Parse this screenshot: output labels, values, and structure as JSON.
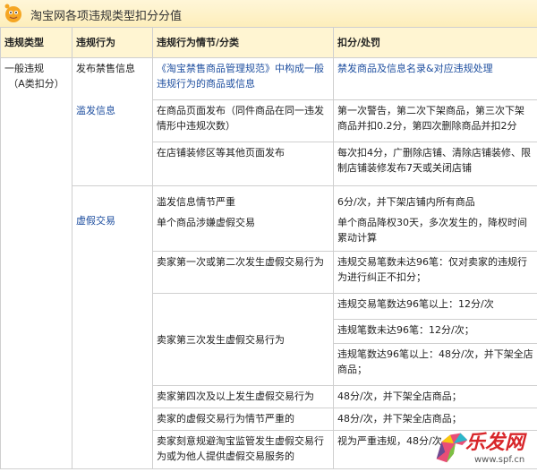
{
  "title": "淘宝网各项违规类型扣分分值",
  "headers": [
    "违规类型",
    "违规行为",
    "违规行为情节/分类",
    "扣分/处罚"
  ],
  "col1": {
    "type_line1": "一般违规",
    "type_line2": "（A类扣分）"
  },
  "behaviors": {
    "b1": "发布禁售信息",
    "b2": "滥发信息",
    "b3": "虚假交易"
  },
  "rows": {
    "r1": {
      "detail": "《淘宝禁售商品管理规范》中构成一般违规行为的商品或信息",
      "penalty": "禁发商品及信息名录&对应违规处理"
    },
    "r2": {
      "detail": "在商品页面发布（同件商品在同一违发情形中违规次数）",
      "penalty": "第一次警告，第二次下架商品，第三次下架商品并扣0.2分，第四次删除商品并扣2分"
    },
    "r3": {
      "detail": "在店铺装修区等其他页面发布",
      "penalty": "每次扣4分，广删除店铺、清除店铺装修、限制店铺装修发布7天或关闭店铺"
    },
    "r4": {
      "detail_a": "滥发信息情节严重",
      "detail_b": "单个商品涉嫌虚假交易",
      "penalty_a": "6分/次，并下架店铺内所有商品",
      "penalty_b": "单个商品降权30天，多次发生的，降权时间累动计算"
    },
    "r5": {
      "detail": "卖家第一次或第二次发生虚假交易行为",
      "penalty": "违规交易笔数未达96笔：仅对卖家的违规行为进行纠正不扣分；"
    },
    "r6": {
      "detail": "卖家第三次发生虚假交易行为",
      "penalty_a": "违规交易笔数达96笔以上：12分/次",
      "penalty_b": "违规笔数未达96笔：12分/次；",
      "penalty_c": "违规笔数达96笔以上：48分/次，并下架全店商品；"
    },
    "r7": {
      "detail": "卖家第四次及以上发生虚假交易行为",
      "penalty": "48分/次，并下架全店商品；"
    },
    "r8": {
      "detail": "卖家的虚假交易行为情节严重的",
      "penalty": "48分/次，并下架全店商品；"
    },
    "r9": {
      "detail": "卖家刻意规避淘宝监管发生虚假交易行为或为他人提供虚假交易服务的",
      "penalty": "视为严重违规，48分/次"
    }
  },
  "watermark": {
    "text": "乐发网",
    "url": "www.spf.cn"
  },
  "colors": {
    "header_bg": "#fff5d2",
    "link_blue": "#2050a0",
    "watermark_red": "#d8262a"
  }
}
